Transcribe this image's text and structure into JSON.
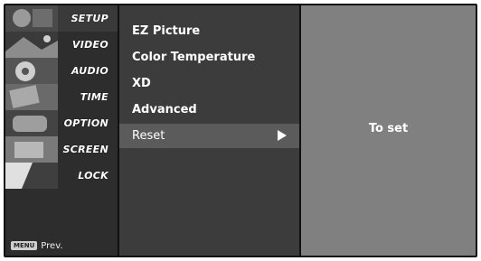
{
  "menu": {
    "items": [
      {
        "label": "SETUP"
      },
      {
        "label": "VIDEO"
      },
      {
        "label": "AUDIO"
      },
      {
        "label": "TIME"
      },
      {
        "label": "OPTION"
      },
      {
        "label": "SCREEN"
      },
      {
        "label": "LOCK"
      }
    ],
    "active_index": 0,
    "menu_key": "MENU",
    "prev_label": "Prev."
  },
  "submenu": {
    "items": [
      {
        "label": "EZ Picture"
      },
      {
        "label": "Color Temperature"
      },
      {
        "label": "XD"
      },
      {
        "label": "Advanced"
      },
      {
        "label": "Reset"
      }
    ],
    "selected_index": 4
  },
  "info_panel": {
    "text": "To set"
  },
  "colors": {
    "frame": "#111111",
    "left_column": "#2d2d2d",
    "submenu_bg": "#3c3c3c",
    "submenu_selected": "#5b5b5b",
    "info_bg": "#808080",
    "text": "#ffffff"
  }
}
